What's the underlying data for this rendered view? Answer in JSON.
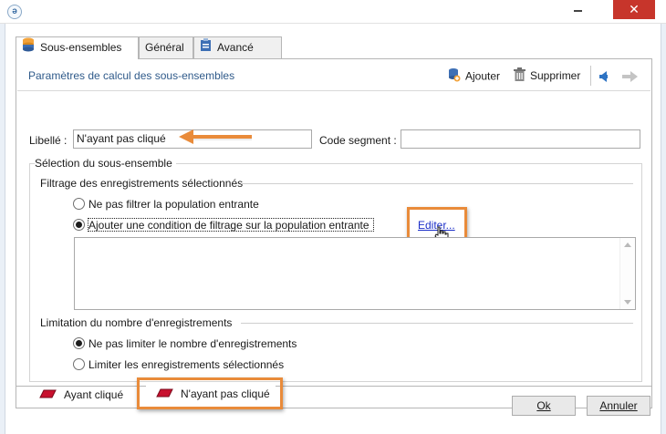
{
  "window": {
    "app_icon": "app-logo-icon",
    "minimize_label": "—",
    "close_label": "✕"
  },
  "tabs": [
    {
      "label": "Sous-ensembles",
      "icon": "database-icon",
      "active": true
    },
    {
      "label": "Général",
      "active": false
    },
    {
      "label": "Avancé",
      "icon": "clipboard-icon",
      "active": false
    }
  ],
  "header": {
    "title": "Paramètres de calcul des sous-ensembles",
    "add_label": "Ajouter",
    "delete_label": "Supprimer"
  },
  "form": {
    "libelle_label": "Libellé :",
    "libelle_value": "N'ayant pas cliqué",
    "code_label": "Code segment :",
    "code_value": ""
  },
  "selection": {
    "title": "Sélection du sous-ensemble",
    "filter_title": "Filtrage des enregistrements sélectionnés",
    "radio_no_filter": "Ne pas filtrer la population entrante",
    "radio_add_condition": "Ajouter une condition de filtrage sur la population entrante",
    "edit_link": "Editer...",
    "limit_title": "Limitation du nombre d'enregistrements",
    "radio_no_limit": "Ne pas limiter le nombre d'enregistrements",
    "radio_limit": "Limiter les enregistrements sélectionnés"
  },
  "subsets": [
    {
      "label": "Ayant cliqué",
      "active": false
    },
    {
      "label": "N'ayant pas cliqué",
      "active": true
    }
  ],
  "buttons": {
    "ok": "Ok",
    "cancel": "Annuler"
  },
  "colors": {
    "highlight": "#e98b3a",
    "link": "#1b2ec8",
    "title_blue": "#2f5a8a",
    "close_red": "#c7352b"
  }
}
